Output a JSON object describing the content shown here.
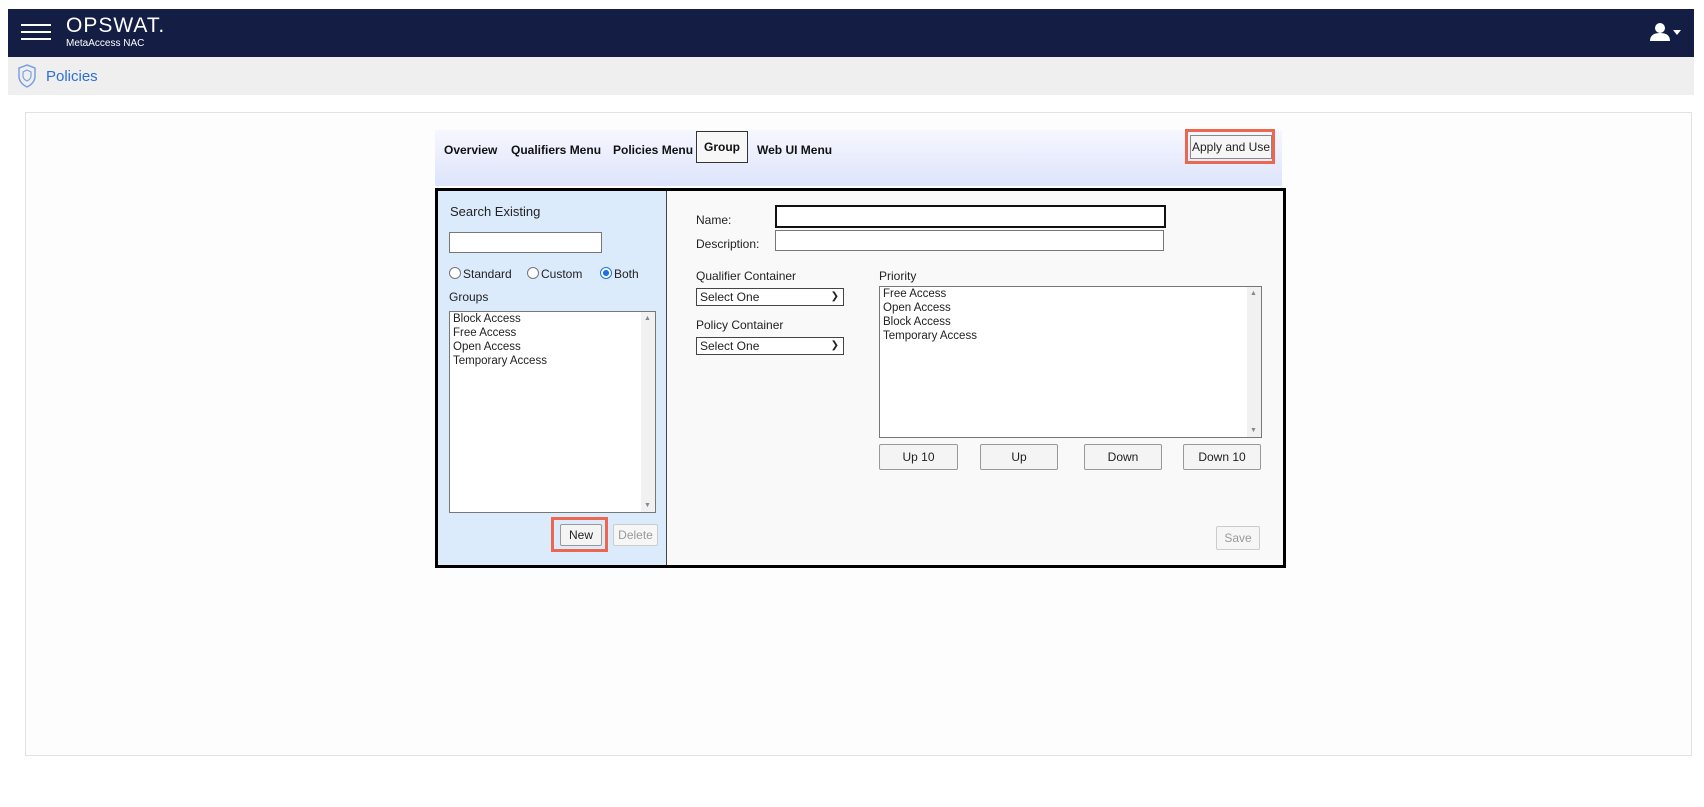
{
  "app": {
    "brand": "OPSWAT.",
    "product": "MetaAccess NAC"
  },
  "page": {
    "title": "Policies"
  },
  "tabs": [
    {
      "label": "Overview"
    },
    {
      "label": "Qualifiers Menu"
    },
    {
      "label": "Policies Menu"
    },
    {
      "label": "Group",
      "active": true
    },
    {
      "label": "Web UI Menu"
    }
  ],
  "toolbar": {
    "apply_label": "Apply and Use"
  },
  "left_panel": {
    "search_label": "Search Existing",
    "search_value": "",
    "filter_options": [
      "Standard",
      "Custom",
      "Both"
    ],
    "filter_selected": "Both",
    "groups_label": "Groups",
    "groups": [
      "Block Access",
      "Free Access",
      "Open Access",
      "Temporary Access"
    ],
    "new_label": "New",
    "delete_label": "Delete"
  },
  "form": {
    "name_label": "Name:",
    "name_value": "",
    "description_label": "Description:",
    "description_value": "",
    "qualifier_container_label": "Qualifier Container",
    "qualifier_container_value": "Select One",
    "policy_container_label": "Policy Container",
    "policy_container_value": "Select One",
    "priority_label": "Priority",
    "priority_items": [
      "Free Access",
      "Open Access",
      "Block Access",
      "Temporary Access"
    ],
    "up10_label": "Up 10",
    "up_label": "Up",
    "down_label": "Down",
    "down10_label": "Down 10",
    "save_label": "Save"
  },
  "colors": {
    "header_bg": "#141e44",
    "title_link": "#2d6fd6",
    "highlight": "#ec6650",
    "left_panel_bg": "#dcebfb"
  }
}
